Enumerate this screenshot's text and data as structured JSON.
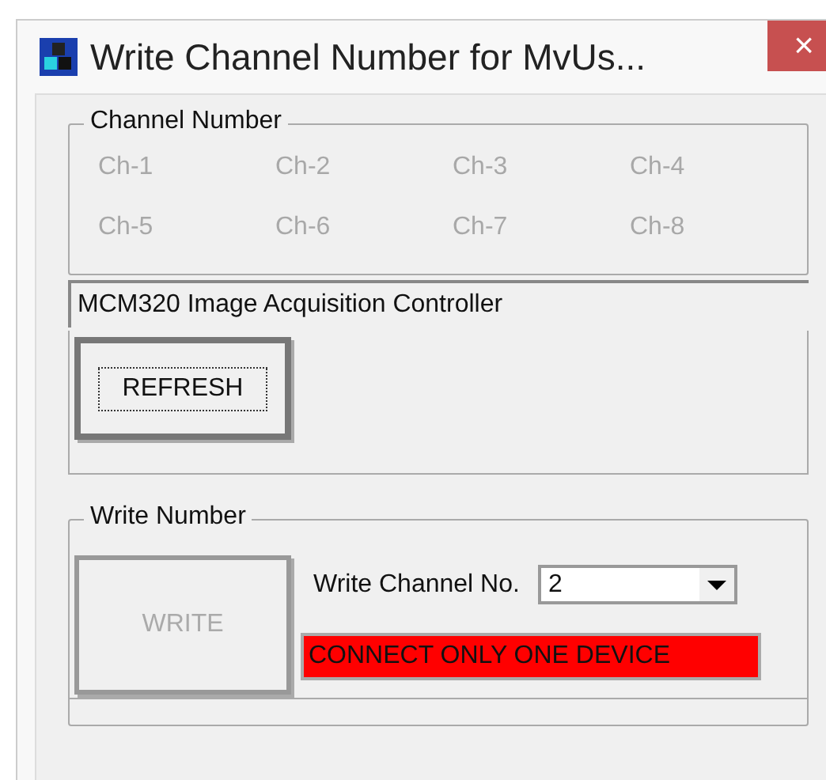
{
  "window": {
    "title": "Write Channel Number for MvUs...",
    "close": "×"
  },
  "channel_group": {
    "label": "Channel Number",
    "channels": [
      {
        "label": "Ch-1",
        "disabled": true
      },
      {
        "label": "Ch-2",
        "disabled": true
      },
      {
        "label": "Ch-3",
        "disabled": true
      },
      {
        "label": "Ch-4",
        "disabled": true
      },
      {
        "label": "Ch-5",
        "disabled": true
      },
      {
        "label": "Ch-6",
        "disabled": true
      },
      {
        "label": "Ch-7",
        "disabled": true
      },
      {
        "label": "Ch-8",
        "disabled": true
      }
    ],
    "device": "MCM320 Image Acquisition Controller",
    "refresh_button": {
      "label": "REFRESH",
      "focused": true
    }
  },
  "write_group": {
    "label": "Write Number",
    "write_button": {
      "label": "WRITE",
      "disabled": true
    },
    "channel_label": "Write Channel No.",
    "channel_select": {
      "value": "2"
    },
    "status": {
      "text": "CONNECT ONLY ONE DEVICE",
      "color": "#ff0000"
    }
  }
}
